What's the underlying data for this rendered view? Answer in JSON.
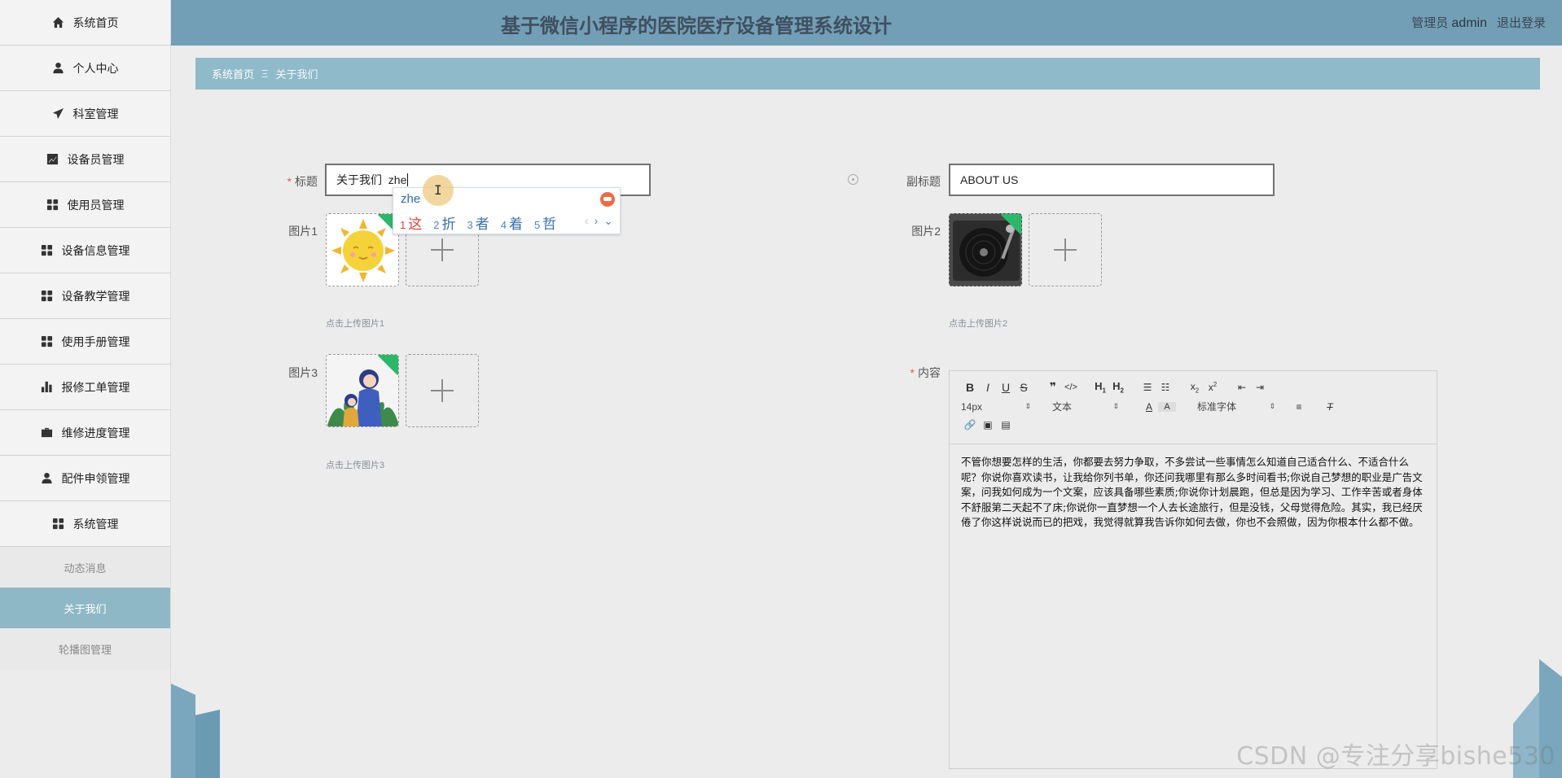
{
  "sidebar": {
    "items": [
      {
        "label": "系统首页",
        "icon": "home-icon"
      },
      {
        "label": "个人中心",
        "icon": "user-icon"
      },
      {
        "label": "科室管理",
        "icon": "send-icon"
      },
      {
        "label": "设备员管理",
        "icon": "chart-line-icon"
      },
      {
        "label": "使用员管理",
        "icon": "grid-icon"
      },
      {
        "label": "设备信息管理",
        "icon": "grid-icon"
      },
      {
        "label": "设备教学管理",
        "icon": "grid-icon"
      },
      {
        "label": "使用手册管理",
        "icon": "grid-icon"
      },
      {
        "label": "报修工单管理",
        "icon": "bar-chart-icon"
      },
      {
        "label": "维修进度管理",
        "icon": "briefcase-icon"
      },
      {
        "label": "配件申领管理",
        "icon": "user-icon"
      },
      {
        "label": "系统管理",
        "icon": "grid-icon"
      }
    ],
    "sub_items": [
      {
        "label": "动态消息",
        "active": false
      },
      {
        "label": "关于我们",
        "active": true
      },
      {
        "label": "轮播图管理",
        "active": false
      }
    ]
  },
  "header": {
    "title": "基于微信小程序的医院医疗设备管理系统设计",
    "role": "管理员",
    "username": "admin",
    "logout": "退出登录"
  },
  "breadcrumb": {
    "home": "系统首页",
    "separator": "Ξ",
    "current": "关于我们"
  },
  "form": {
    "title_label": "标题",
    "title_value": "关于我们  zhe",
    "subtitle_label": "副标题",
    "subtitle_value": "ABOUT US",
    "pic1_label": "图片1",
    "pic1_hint": "点击上传图片1",
    "pic2_label": "图片2",
    "pic2_hint": "点击上传图片2",
    "pic3_label": "图片3",
    "pic3_hint": "点击上传图片3",
    "content_label": "内容"
  },
  "ime": {
    "pinyin": "zhe",
    "candidates": [
      {
        "num": "1",
        "word": "这"
      },
      {
        "num": "2",
        "word": "折"
      },
      {
        "num": "3",
        "word": "者"
      },
      {
        "num": "4",
        "word": "着"
      },
      {
        "num": "5",
        "word": "哲"
      }
    ]
  },
  "editor": {
    "font_size": "14px",
    "text_type": "文本",
    "font_family": "标准字体",
    "content": "不管你想要怎样的生活，你都要去努力争取，不多尝试一些事情怎么知道自己适合什么、不适合什么呢？你说你喜欢读书，让我给你列书单，你还问我哪里有那么多时间看书;你说自己梦想的职业是广告文案，问我如何成为一个文案，应该具备哪些素质;你说你计划晨跑，但总是因为学习、工作辛苦或者身体不舒服第二天起不了床;你说你一直梦想一个人去长途旅行，但是没钱，父母觉得危险。其实，我已经厌倦了你这样说说而已的把戏，我觉得就算我告诉你如何去做，你也不会照做，因为你根本什么都不做。"
  },
  "watermark": "CSDN @专注分享bishe530",
  "colors": {
    "header": "#739fb6",
    "breadcrumb": "#8fbac9",
    "active_sub": "#8fb8c7",
    "required": "#e05a5a"
  }
}
